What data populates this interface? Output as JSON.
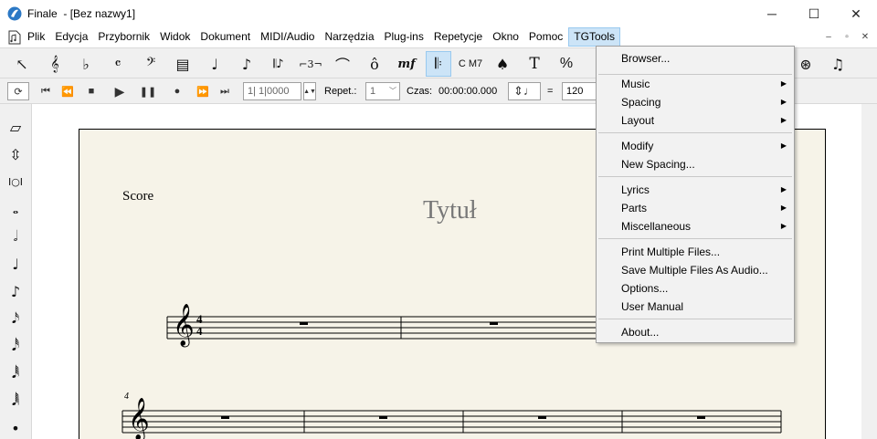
{
  "window": {
    "app_name": "Finale",
    "doc_title": "- [Bez nazwy1]",
    "minimize": "─",
    "maximize": "☐",
    "close": "✕"
  },
  "menubar": {
    "items": [
      "Plik",
      "Edycja",
      "Przybornik",
      "Widok",
      "Dokument",
      "MIDI/Audio",
      "Narzędzia",
      "Plug-ins",
      "Repetycje",
      "Okno",
      "Pomoc",
      "TGTools"
    ],
    "active": "TGTools",
    "mdi": [
      "–",
      "▫",
      "✕"
    ]
  },
  "toolbar": {
    "tools": [
      {
        "name": "selection-tool",
        "glyph": "↖"
      },
      {
        "name": "staff-tool",
        "glyph": "𝄞"
      },
      {
        "name": "key-signature-tool",
        "glyph": "♭"
      },
      {
        "name": "time-signature-tool",
        "glyph": "𝄴"
      },
      {
        "name": "clef-tool",
        "glyph": "𝄢"
      },
      {
        "name": "measure-tool",
        "glyph": "▤"
      },
      {
        "name": "simple-entry-tool",
        "glyph": "♩"
      },
      {
        "name": "speedy-entry-tool",
        "glyph": "♪"
      },
      {
        "name": "hyperscribe-tool",
        "glyph": "𝄃♪"
      },
      {
        "name": "tuplet-tool",
        "glyph": "⌐3¬"
      },
      {
        "name": "smart-shape-tool",
        "glyph": "⌒"
      },
      {
        "name": "articulation-tool",
        "glyph": "ô"
      },
      {
        "name": "expression-tool",
        "glyph": "mf"
      },
      {
        "name": "repeat-tool",
        "glyph": "𝄆"
      },
      {
        "name": "chord-tool",
        "glyph": "C M7"
      },
      {
        "name": "lyrics-tool",
        "glyph": "♠"
      },
      {
        "name": "text-tool",
        "glyph": "T"
      },
      {
        "name": "resize-tool",
        "glyph": "%"
      }
    ],
    "right_tools": [
      {
        "name": "mirror-tool",
        "glyph": "⊛"
      },
      {
        "name": "midi-tool",
        "glyph": "♫"
      }
    ]
  },
  "playback": {
    "measure_value": "1| 1|0000",
    "repet_label": "Repet.:",
    "repet_value": "1",
    "time_label": "Czas:",
    "time_value": "00:00:00.000",
    "tempo_equals": "=",
    "tempo_value": "120"
  },
  "palette": [
    "eraser",
    "spacer",
    "slash",
    "whole-note",
    "half-note",
    "quarter-note",
    "eighth-note",
    "sixteenth-note",
    "thirty-second-note",
    "sixty-fourth-note",
    "hundred-twenty-eighth-note",
    "dot"
  ],
  "score": {
    "part_label": "Score",
    "title": "Tytuł",
    "time_sig_top": "4",
    "time_sig_bottom": "4",
    "system2_measure_number": "4"
  },
  "tgtools_menu": [
    {
      "label": "Browser...",
      "submenu": false
    },
    {
      "separator": true
    },
    {
      "label": "Music",
      "submenu": true
    },
    {
      "label": "Spacing",
      "submenu": true
    },
    {
      "label": "Layout",
      "submenu": true
    },
    {
      "separator": true
    },
    {
      "label": "Modify",
      "submenu": true
    },
    {
      "label": "New Spacing...",
      "submenu": false
    },
    {
      "separator": true
    },
    {
      "label": "Lyrics",
      "submenu": true
    },
    {
      "label": "Parts",
      "submenu": true
    },
    {
      "label": "Miscellaneous",
      "submenu": true
    },
    {
      "separator": true
    },
    {
      "label": "Print Multiple Files...",
      "submenu": false
    },
    {
      "label": "Save Multiple Files As Audio...",
      "submenu": false
    },
    {
      "label": "Options...",
      "submenu": false
    },
    {
      "label": "User Manual",
      "submenu": false
    },
    {
      "separator": true
    },
    {
      "label": "About...",
      "submenu": false
    }
  ]
}
